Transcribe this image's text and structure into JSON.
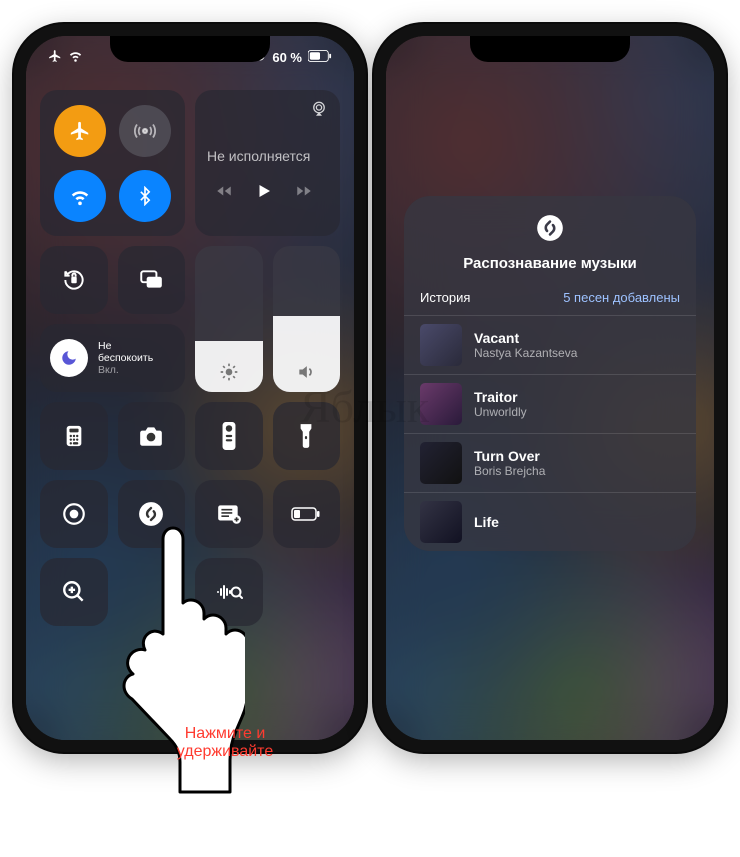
{
  "status": {
    "battery_text": "60 %"
  },
  "media": {
    "not_playing": "Не исполняется"
  },
  "dnd": {
    "line1": "Не",
    "line2": "беспокоить",
    "on_label": "Вкл."
  },
  "hand": {
    "label": "Нажмите и удерживайте"
  },
  "shazam": {
    "title": "Распознавание музыки",
    "history_label": "История",
    "added_label": "5 песен добавлены",
    "songs": [
      {
        "title": "Vacant",
        "artist": "Nastya Kazantseva"
      },
      {
        "title": "Traitor",
        "artist": "Unworldly"
      },
      {
        "title": "Turn Over",
        "artist": "Boris Brejcha"
      },
      {
        "title": "Life",
        "artist": ""
      }
    ]
  },
  "watermark": "Яблык"
}
